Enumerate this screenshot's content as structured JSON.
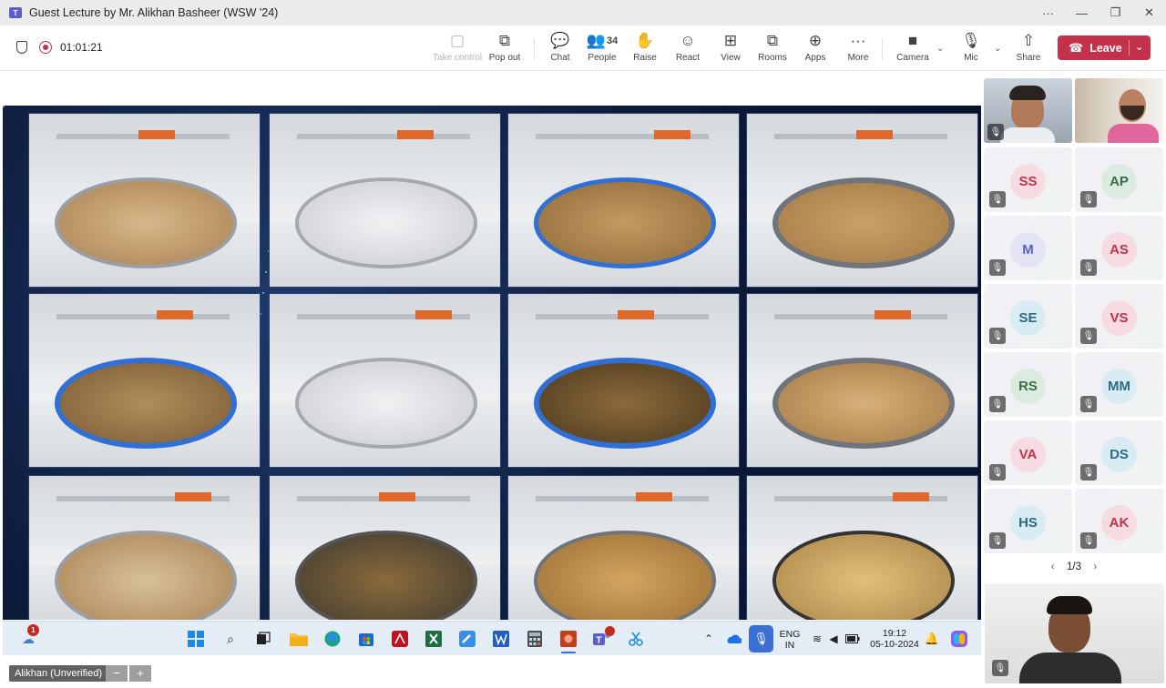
{
  "window": {
    "title": "Guest Lecture by Mr. Alikhan Basheer (WSW '24)",
    "controls": {
      "more": "···",
      "minimize": "—",
      "restore": "❐",
      "close": "✕"
    }
  },
  "meeting": {
    "timer": "01:01:21"
  },
  "toolbar": {
    "take_control": "Take control",
    "pop_out": "Pop out",
    "chat": "Chat",
    "people": "People",
    "people_count": "34",
    "raise": "Raise",
    "react": "React",
    "view": "View",
    "rooms": "Rooms",
    "apps": "Apps",
    "more": "More",
    "camera": "Camera",
    "mic": "Mic",
    "share": "Share",
    "leave": "Leave"
  },
  "icons": {
    "take_control": "▢",
    "pop_out": "⧉",
    "chat": "💬",
    "people": "👥",
    "raise": "✋",
    "react": "☺",
    "view": "⊞",
    "rooms": "⧉",
    "apps": "⊕",
    "more": "···",
    "camera": "■",
    "mic": "🎙",
    "share": "⇧",
    "phone": "☎",
    "caret": "⌄",
    "mute": "🎙"
  },
  "shared_screen": {
    "photos": [
      "polishing-machine-1",
      "polishing-machine-2",
      "polishing-machine-3",
      "polishing-machine-4",
      "polishing-machine-5",
      "polishing-machine-6",
      "polishing-machine-7",
      "polishing-machine-8",
      "polishing-machine-9",
      "polishing-machine-10",
      "polishing-machine-11",
      "polishing-machine-12"
    ]
  },
  "taskbar": {
    "notification_badge": "1",
    "language_line1": "ENG",
    "language_line2": "IN",
    "time": "19:12",
    "date": "05-10-2024",
    "apps": [
      "start",
      "search",
      "task-view",
      "file-explorer",
      "edge",
      "store",
      "acrobat",
      "excel",
      "paint",
      "word",
      "calculator",
      "powerpoint",
      "teams",
      "snipping-tool"
    ]
  },
  "statusbar": {
    "user_tag": "Alikhan (Unverified)",
    "zoom_out": "−",
    "zoom_in": "+"
  },
  "roster": {
    "participants": [
      {
        "initials": "SS",
        "color": "#c4314b",
        "bg": "#f6dce0"
      },
      {
        "initials": "AP",
        "color": "#3a6b4a",
        "bg": "#dcebe0"
      },
      {
        "initials": "M",
        "color": "#5b5fc7",
        "bg": "#e3e3f6"
      },
      {
        "initials": "AS",
        "color": "#c4314b",
        "bg": "#f6dce0"
      },
      {
        "initials": "SE",
        "color": "#2b6a86",
        "bg": "#d9ebf3"
      },
      {
        "initials": "VS",
        "color": "#c4314b",
        "bg": "#f6dce0"
      },
      {
        "initials": "RS",
        "color": "#3a6b4a",
        "bg": "#dcebe0"
      },
      {
        "initials": "MM",
        "color": "#2b6a86",
        "bg": "#d9ebf3"
      },
      {
        "initials": "VA",
        "color": "#c4314b",
        "bg": "#f6dce0"
      },
      {
        "initials": "DS",
        "color": "#2b6a86",
        "bg": "#d9ebf3"
      },
      {
        "initials": "HS",
        "color": "#2b6a86",
        "bg": "#d9ebf3"
      },
      {
        "initials": "AK",
        "color": "#c4314b",
        "bg": "#f6dce0"
      }
    ],
    "pager": "1/3",
    "prev": "‹",
    "next": "›"
  },
  "colors": {
    "accent": "#5b5fc7",
    "leave": "#c4314b",
    "recording": "#c4314b",
    "mic_active": "#3b6fd3"
  }
}
